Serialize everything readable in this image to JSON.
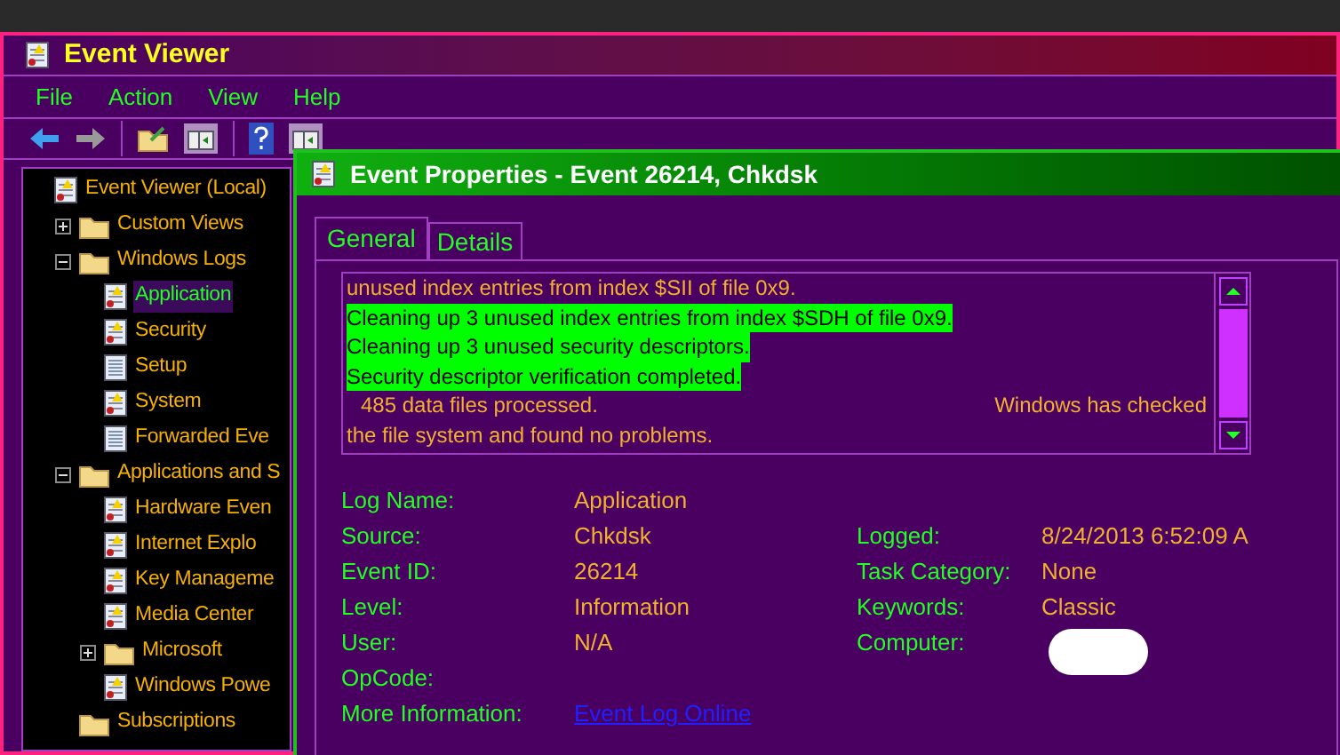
{
  "window": {
    "title": "Event Viewer"
  },
  "menu": [
    "File",
    "Action",
    "View",
    "Help"
  ],
  "toolbar": [
    {
      "kind": "back"
    },
    {
      "kind": "forward"
    },
    {
      "kind": "sep"
    },
    {
      "kind": "folder"
    },
    {
      "kind": "panel"
    },
    {
      "kind": "sep"
    },
    {
      "kind": "help"
    },
    {
      "kind": "panel"
    }
  ],
  "tree": [
    {
      "label": "Event Viewer (Local)",
      "kind": "log",
      "selected": false,
      "children": [
        {
          "label": "Custom Views",
          "kind": "folder",
          "expanded": false,
          "selected": false
        },
        {
          "label": "Windows Logs",
          "kind": "folder",
          "expanded": true,
          "selected": false,
          "children": [
            {
              "label": "Application",
              "kind": "log",
              "selected": true
            },
            {
              "label": "Security",
              "kind": "log",
              "selected": false
            },
            {
              "label": "Setup",
              "kind": "list",
              "selected": false
            },
            {
              "label": "System",
              "kind": "log",
              "selected": false
            },
            {
              "label": "Forwarded Eve",
              "kind": "list",
              "selected": false
            }
          ]
        },
        {
          "label": "Applications and S",
          "kind": "folder",
          "expanded": true,
          "selected": false,
          "children": [
            {
              "label": "Hardware Even",
              "kind": "log",
              "selected": false
            },
            {
              "label": "Internet Explo",
              "kind": "log",
              "selected": false
            },
            {
              "label": "Key Manageme",
              "kind": "log",
              "selected": false
            },
            {
              "label": "Media Center",
              "kind": "log",
              "selected": false
            },
            {
              "label": "Microsoft",
              "kind": "folder",
              "expanded": false,
              "selected": false
            },
            {
              "label": "Windows Powe",
              "kind": "log",
              "selected": false
            }
          ]
        },
        {
          "label": "Subscriptions",
          "kind": "folder",
          "selected": false
        }
      ]
    }
  ],
  "dialog": {
    "title": "Event Properties - Event 26214, Chkdsk",
    "tabs": [
      {
        "label": "General",
        "selected": true
      },
      {
        "label": "Details",
        "selected": false
      }
    ],
    "message_lines": [
      {
        "text": "unused index entries from index $SII of file 0x9.",
        "highlighted": false
      },
      {
        "text": "Cleaning up 3 unused index entries from index $SDH of file 0x9.",
        "highlighted": true
      },
      {
        "text": "Cleaning up 3 unused security descriptors.",
        "highlighted": true
      },
      {
        "text": "Security descriptor verification completed.",
        "highlighted": true
      },
      {
        "text": "485 data files processed.",
        "right": "Windows has checked",
        "highlighted": false
      },
      {
        "text": "the file system and found no problems.",
        "highlighted": false
      }
    ],
    "fields_left": [
      {
        "label": "Log Name:",
        "value": "Application"
      },
      {
        "label": "Source:",
        "value": "Chkdsk"
      },
      {
        "label": "Event ID:",
        "value": "26214"
      },
      {
        "label": "Level:",
        "value": "Information"
      },
      {
        "label": "User:",
        "value": "N/A"
      },
      {
        "label": "OpCode:"
      },
      {
        "label": "More Information:",
        "link": "Event Log Online"
      }
    ],
    "fields_right": [
      {
        "label": "Logged:",
        "value": "8/24/2013 6:52:09 A"
      },
      {
        "label": "Task Category:",
        "value": "None"
      },
      {
        "label": "Keywords:",
        "value": "Classic"
      },
      {
        "label": "Computer:",
        "redacted": true
      }
    ]
  }
}
